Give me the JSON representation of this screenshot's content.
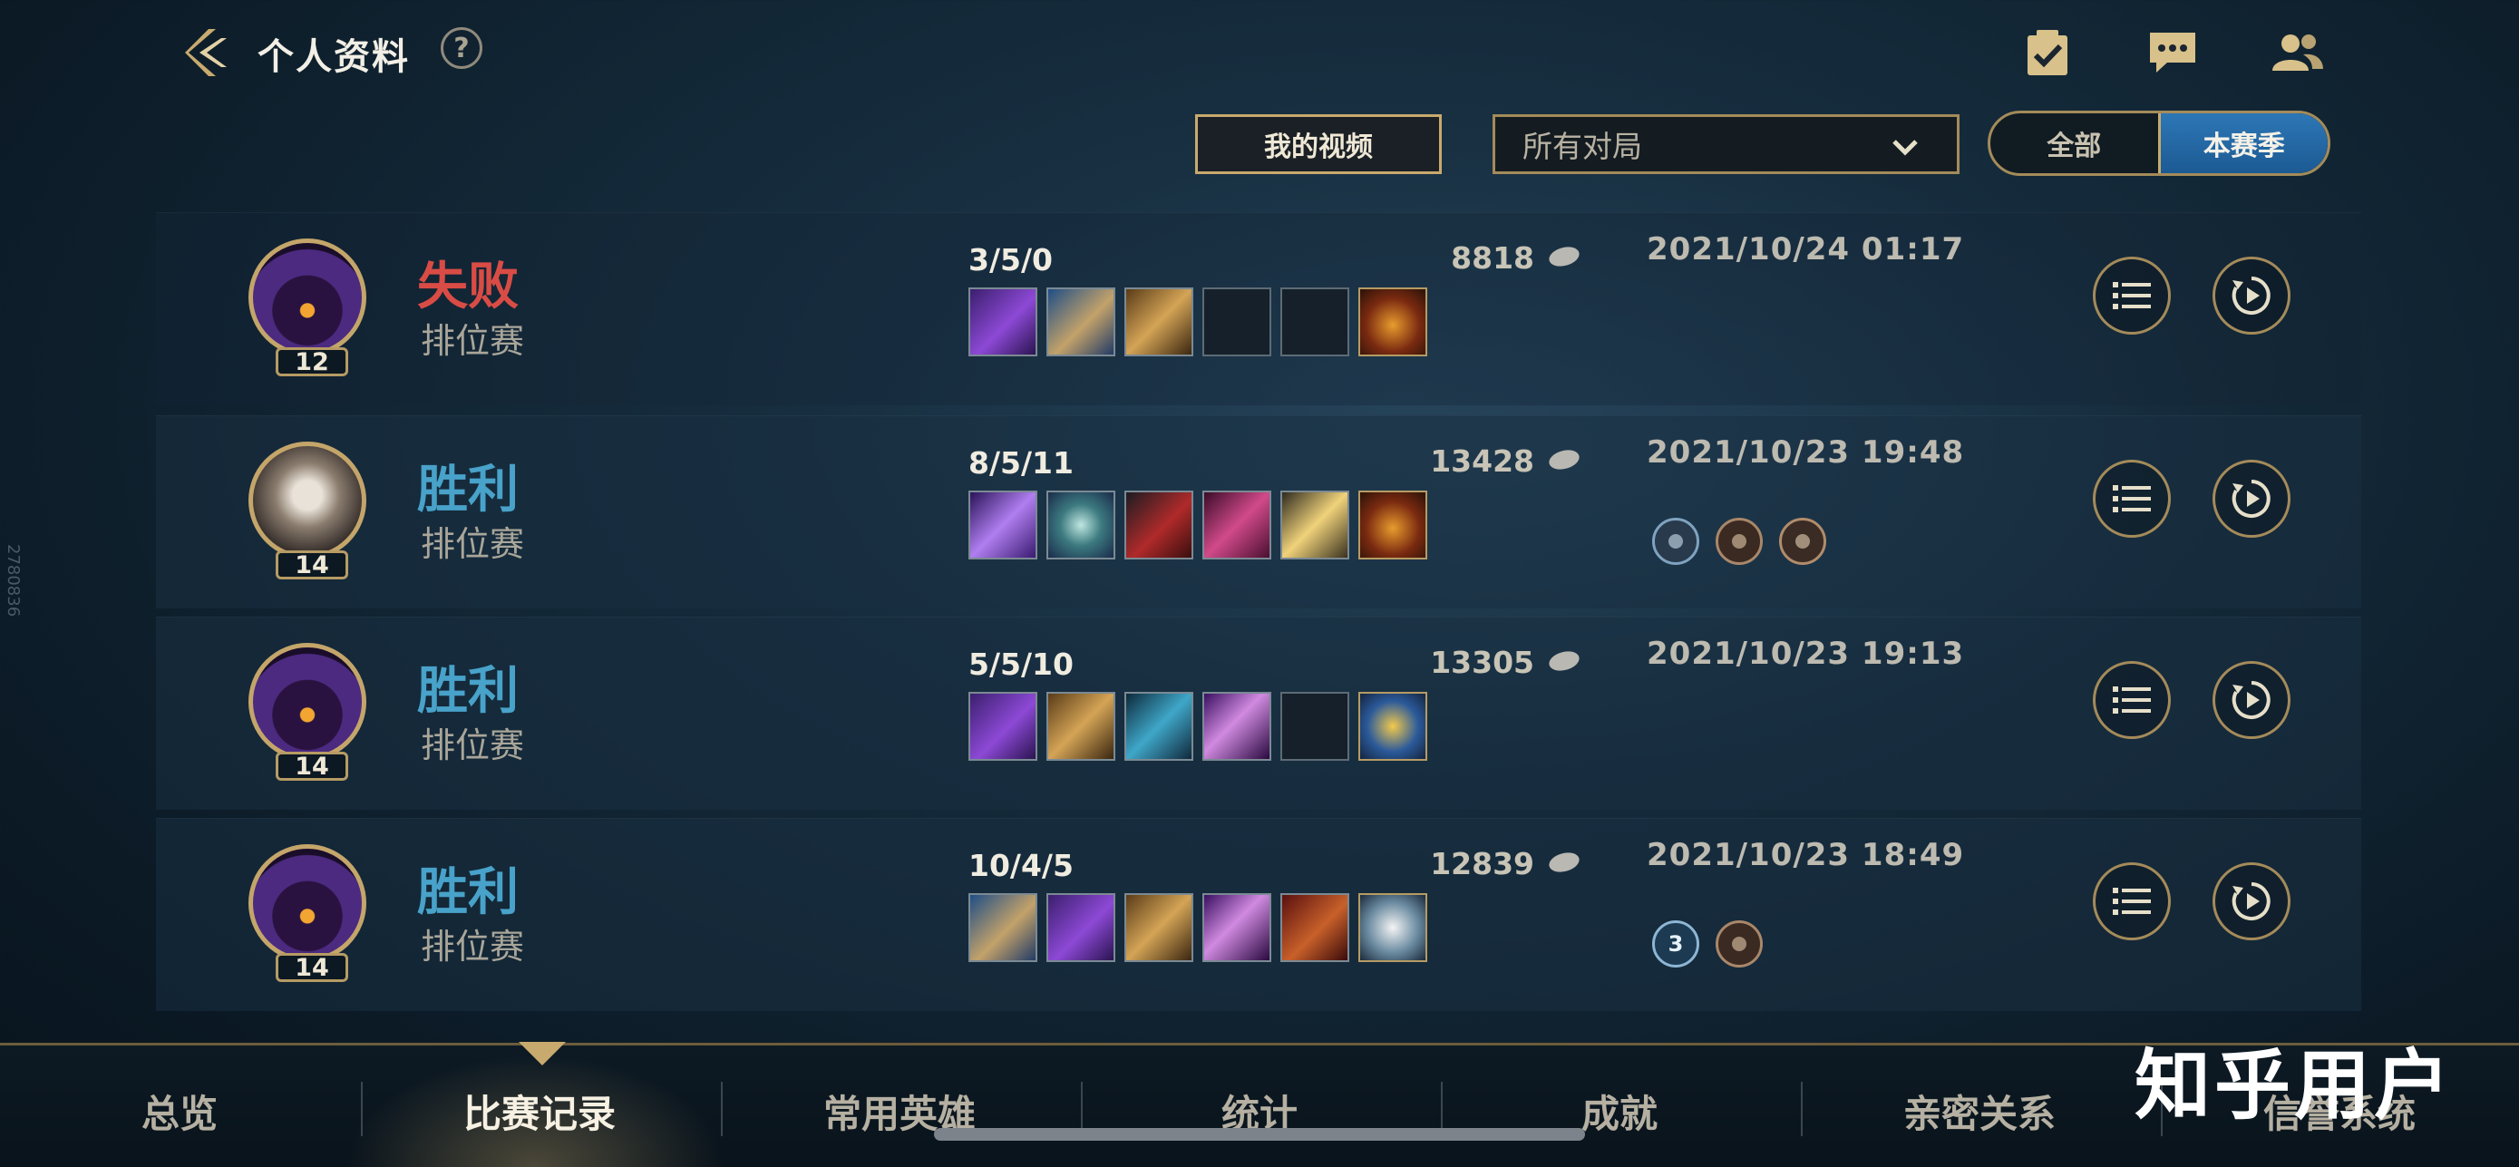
{
  "header": {
    "title": "个人资料",
    "help_label": "?",
    "icons": [
      "checklist-icon",
      "chat-icon",
      "friends-icon"
    ]
  },
  "filters": {
    "video_label": "我的视频",
    "match_filter_value": "所有对局",
    "season_toggle": {
      "all_label": "全部",
      "season_label": "本赛季",
      "selected": "本赛季"
    }
  },
  "side_id": "2780836",
  "matches": [
    {
      "result": "失败",
      "result_color": "#d94c45",
      "mode": "排位赛",
      "level": "12",
      "kda": "3/5/0",
      "gold": "8818",
      "date": "2021/10/24 01:17",
      "items": [
        "purple-staff",
        "blue-tome",
        "gold-armor",
        "empty",
        "empty",
        "trinket-lantern"
      ],
      "badges": []
    },
    {
      "result": "胜利",
      "result_color": "#48a2c9",
      "mode": "排位赛",
      "level": "14",
      "kda": "8/5/11",
      "gold": "13428",
      "date": "2021/10/23 19:48",
      "items": [
        "purple-sword",
        "green-shuriken",
        "red-gauntlet",
        "crimson-blade",
        "golden-spear",
        "trinket-lantern"
      ],
      "badges": [
        "kill-badge",
        "tower-badge",
        "objective-badge"
      ]
    },
    {
      "result": "胜利",
      "result_color": "#48a2c9",
      "mode": "排位赛",
      "level": "14",
      "kda": "5/5/10",
      "gold": "13305",
      "date": "2021/10/23 19:13",
      "items": [
        "purple-staff",
        "gold-armor",
        "blue-helm",
        "violet-hat",
        "empty",
        "trinket-hourglass"
      ],
      "badges": []
    },
    {
      "result": "胜利",
      "result_color": "#48a2c9",
      "mode": "排位赛",
      "level": "14",
      "kda": "10/4/5",
      "gold": "12839",
      "date": "2021/10/23 18:49",
      "items": [
        "blue-tome",
        "purple-staff",
        "gold-armor",
        "violet-hat",
        "red-book",
        "white-ward"
      ],
      "badges": [
        "triple-kill-badge",
        "tower-badge"
      ],
      "badge_text": "3"
    }
  ],
  "nav": {
    "tabs": [
      "总览",
      "比赛记录",
      "常用英雄",
      "统计",
      "成就",
      "亲密关系",
      "信誉系统"
    ],
    "active": "比赛记录"
  },
  "watermark": "知乎用户",
  "colors": {
    "gold": "#c8aa6e",
    "win": "#48a2c9",
    "loss": "#d94c45",
    "toggle_active": "#2d77b6"
  }
}
